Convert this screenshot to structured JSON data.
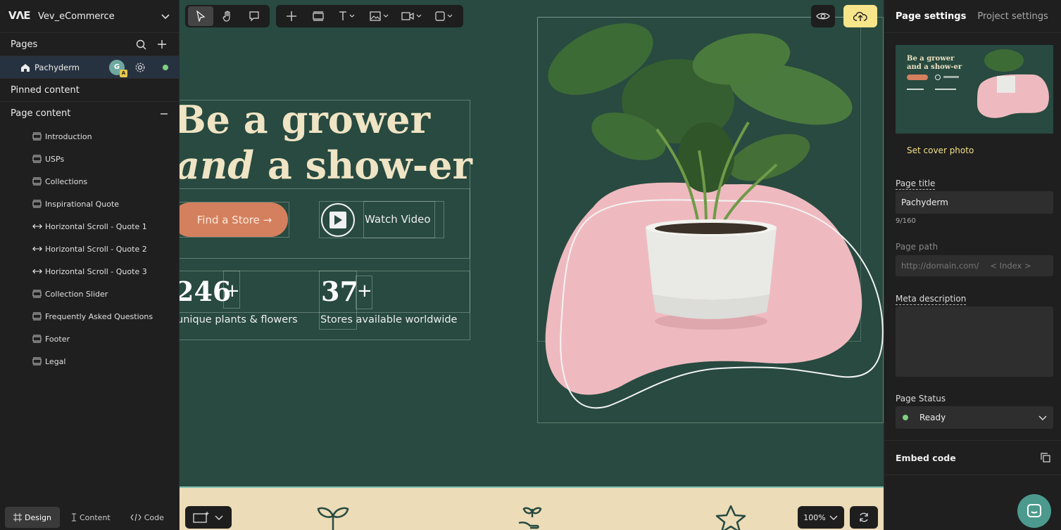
{
  "project": {
    "logo": "VΛE",
    "name": "Vev_eCommerce"
  },
  "pages_section": {
    "title": "Pages"
  },
  "current_page": {
    "name": "Pachyderm",
    "avatar_initials": "G",
    "avatar_sub": "A"
  },
  "pinned": {
    "title": "Pinned content"
  },
  "page_content": {
    "title": "Page content",
    "items": [
      {
        "label": "Introduction",
        "icon": "section"
      },
      {
        "label": "USPs",
        "icon": "section"
      },
      {
        "label": "Collections",
        "icon": "section"
      },
      {
        "label": "Inspirational Quote",
        "icon": "section"
      },
      {
        "label": "Horizontal Scroll - Quote 1",
        "icon": "horizontal"
      },
      {
        "label": "Horizontal Scroll - Quote 2",
        "icon": "horizontal"
      },
      {
        "label": "Horizontal Scroll - Quote 3",
        "icon": "horizontal"
      },
      {
        "label": "Collection Slider",
        "icon": "section"
      },
      {
        "label": "Frequently Asked Questions",
        "icon": "section"
      },
      {
        "label": "Footer",
        "icon": "section"
      },
      {
        "label": "Legal",
        "icon": "section"
      }
    ]
  },
  "bottom_tabs": {
    "design": "Design",
    "content": "Content",
    "code": "Code"
  },
  "canvas": {
    "hero_line1": "Be a grower",
    "hero_line2_italic": "and",
    "hero_line2_rest": " a show-er",
    "cta_label": "Find a Store →",
    "video_label": "Watch Video",
    "stat1_num": "246",
    "stat1_plus": "+",
    "stat1_label": "unique plants & flowers",
    "stat2_num": "37",
    "stat2_plus": "+",
    "stat2_label": "Stores available worldwide",
    "zoom": "100%",
    "colors": {
      "bg": "#284a40",
      "cream": "#efe4c4",
      "blob": "#eebac0",
      "cta": "#d4805e",
      "strip": "#ecdcb8"
    }
  },
  "right_panel": {
    "tab_page": "Page settings",
    "tab_project": "Project settings",
    "cover_line1": "Be a grower",
    "cover_line2": "and a show-er",
    "set_cover": "Set cover photo",
    "page_title_label": "Page title",
    "page_title_value": "Pachyderm",
    "page_title_count": "9/160",
    "page_path_label": "Page path",
    "page_path_domain": "http://domain.com/",
    "page_path_index": "< Index >",
    "meta_label": "Meta description",
    "status_label": "Page Status",
    "status_value": "Ready",
    "embed_label": "Embed code"
  }
}
